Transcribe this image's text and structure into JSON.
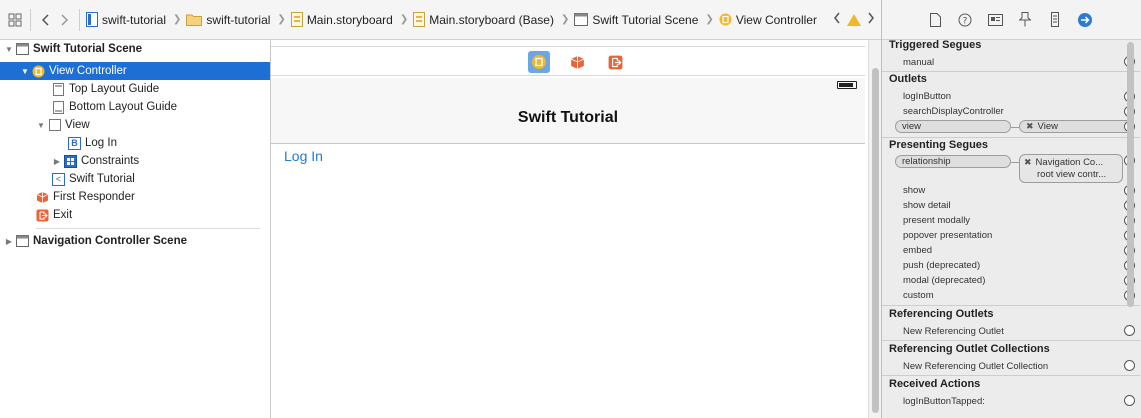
{
  "jumpbar": {
    "crumbs": [
      "swift-tutorial",
      "swift-tutorial",
      "Main.storyboard",
      "Main.storyboard (Base)",
      "Swift Tutorial Scene",
      "View Controller"
    ]
  },
  "navigator": {
    "rows": [
      {
        "label": "Swift Tutorial Scene",
        "icon": "scene-icon"
      },
      {
        "label": "View Controller",
        "icon": "view-controller-icon"
      },
      {
        "label": "Top Layout Guide",
        "icon": "layout-guide-icon"
      },
      {
        "label": "Bottom Layout Guide",
        "icon": "layout-guide-icon"
      },
      {
        "label": "View",
        "icon": "view-icon"
      },
      {
        "label": "Log In",
        "icon": "button-icon",
        "glyph": "B"
      },
      {
        "label": "Constraints",
        "icon": "constraints-icon"
      },
      {
        "label": "Swift Tutorial",
        "icon": "navigation-item-icon",
        "glyph": "<"
      },
      {
        "label": "First Responder",
        "icon": "first-responder-icon"
      },
      {
        "label": "Exit",
        "icon": "exit-icon"
      },
      {
        "label": "Navigation Controller Scene",
        "icon": "scene-icon"
      }
    ]
  },
  "canvas": {
    "nav_title": "Swift Tutorial",
    "login_button": "Log In"
  },
  "inspector": {
    "triggered_segues": {
      "title": "Triggered Segues",
      "items": [
        "manual"
      ]
    },
    "outlets": {
      "title": "Outlets",
      "items": [
        "logInButton",
        "searchDisplayController",
        "view"
      ],
      "view_target": "View"
    },
    "presenting_segues": {
      "title": "Presenting Segues",
      "relationship": "relationship",
      "target_line1": "Navigation Co...",
      "target_line2": "root view contr...",
      "items": [
        "show",
        "show detail",
        "present modally",
        "popover presentation",
        "embed",
        "push (deprecated)",
        "modal (deprecated)",
        "custom"
      ]
    },
    "referencing_outlets": {
      "title": "Referencing Outlets",
      "item": "New Referencing Outlet"
    },
    "referencing_outlet_collections": {
      "title": "Referencing Outlet Collections",
      "item": "New Referencing Outlet Collection"
    },
    "received_actions": {
      "title": "Received Actions",
      "item": "logInButtonTapped:"
    }
  },
  "colors": {
    "selection": "#1d6fd6",
    "link": "#1f7ed0",
    "inspector_accent": "#2b7bd6"
  }
}
